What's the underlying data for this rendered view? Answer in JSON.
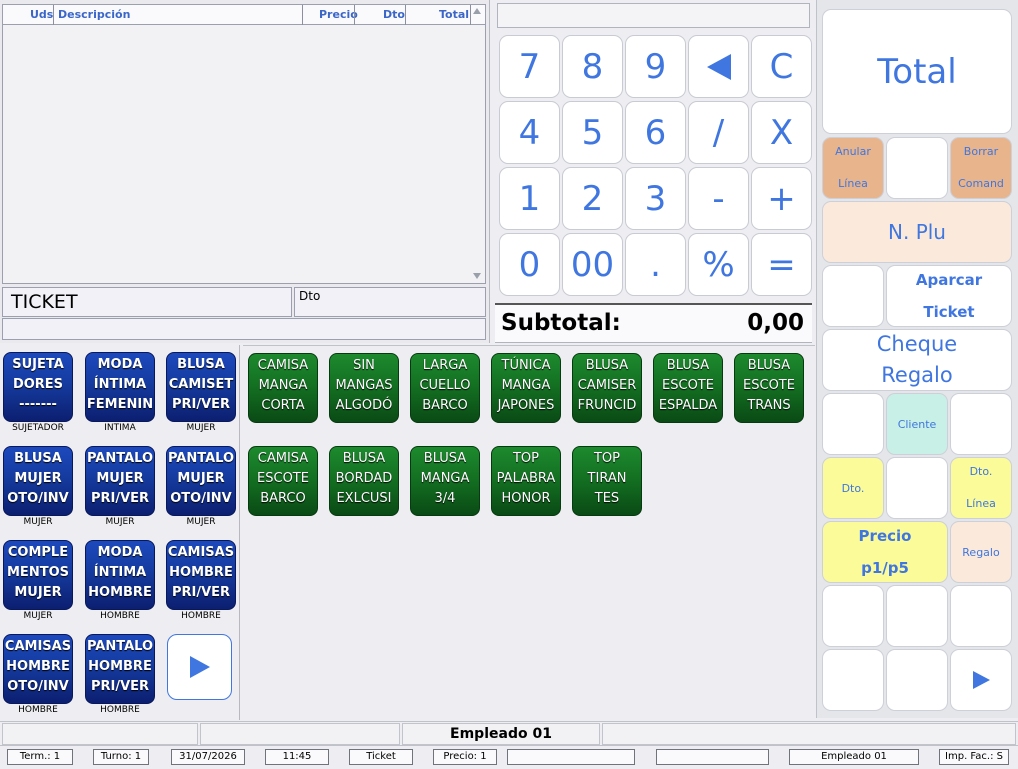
{
  "ticket": {
    "columns": {
      "uds": "Uds",
      "descripcion": "Descripción",
      "precio": "Precio",
      "dto": "Dto",
      "total": "Total"
    },
    "label": "TICKET",
    "dto_label": "Dto"
  },
  "keypad": {
    "rows": [
      [
        "7",
        "8",
        "9",
        "◀",
        "C"
      ],
      [
        "4",
        "5",
        "6",
        "/",
        "X"
      ],
      [
        "1",
        "2",
        "3",
        "-",
        "+"
      ],
      [
        "0",
        "00",
        ".",
        "%",
        "="
      ]
    ]
  },
  "subtotal": {
    "label": "Subtotal:",
    "value": "0,00"
  },
  "right": {
    "total": "Total",
    "anular_linea": [
      "Anular",
      "Línea"
    ],
    "borrar_comanda": [
      "Borrar",
      "Comand"
    ],
    "nplu": "N. Plu",
    "aparcar_ticket": [
      "Aparcar",
      "Ticket"
    ],
    "cheque_regalo": [
      "Cheque",
      "Regalo"
    ],
    "cliente": "Cliente",
    "dto": "Dto.",
    "dto_linea": [
      "Dto.",
      "Línea"
    ],
    "precio": [
      "Precio",
      "p1/p5"
    ],
    "regalo": "Regalo"
  },
  "families": [
    {
      "lines": [
        "SUJETA",
        "DORES",
        "-------"
      ],
      "caption": "SUJETADOR"
    },
    {
      "lines": [
        "MODA",
        "ÍNTIMA",
        "FEMENIN"
      ],
      "caption": "INTIMA"
    },
    {
      "lines": [
        "BLUSA",
        "CAMISET",
        "PRI/VER"
      ],
      "caption": "MUJER"
    },
    {
      "lines": [
        "BLUSA",
        "MUJER",
        "OTO/INV"
      ],
      "caption": "MUJER"
    },
    {
      "lines": [
        "PANTALO",
        "MUJER",
        "PRI/VER"
      ],
      "caption": "MUJER"
    },
    {
      "lines": [
        "PANTALO",
        "MUJER",
        "OTO/INV"
      ],
      "caption": "MUJER"
    },
    {
      "lines": [
        "COMPLE",
        "MENTOS",
        "MUJER"
      ],
      "caption": "MUJER"
    },
    {
      "lines": [
        "MODA",
        "ÍNTIMA",
        "HOMBRE"
      ],
      "caption": "HOMBRE"
    },
    {
      "lines": [
        "CAMISAS",
        "HOMBRE",
        "PRI/VER"
      ],
      "caption": "HOMBRE"
    },
    {
      "lines": [
        "CAMISAS",
        "HOMBRE",
        "OTO/INV"
      ],
      "caption": "HOMBRE"
    },
    {
      "lines": [
        "PANTALO",
        "HOMBRE",
        "PRI/VER"
      ],
      "caption": "HOMBRE"
    }
  ],
  "products": [
    [
      "CAMISA",
      "MANGA",
      "CORTA"
    ],
    [
      "SIN",
      "MANGAS",
      "ALGODÓ"
    ],
    [
      "LARGA",
      "CUELLO",
      "BARCO"
    ],
    [
      "TÚNICA",
      "MANGA",
      "JAPONES"
    ],
    [
      "BLUSA",
      "CAMISER",
      "FRUNCID"
    ],
    [
      "BLUSA",
      "ESCOTE",
      "ESPALDA"
    ],
    [
      "BLUSA",
      "ESCOTE",
      "TRANS"
    ],
    [
      "CAMISA",
      "ESCOTE",
      "BARCO"
    ],
    [
      "BLUSA",
      "BORDAD",
      "EXLCUSI"
    ],
    [
      "BLUSA",
      "MANGA",
      "3/4"
    ],
    [
      "TOP",
      "PALABRA",
      "HONOR"
    ],
    [
      "TOP",
      "TIRAN",
      "TES"
    ]
  ],
  "employee": "Empleado 01",
  "status": {
    "term": "Term.: 1",
    "turno": "Turno: 1",
    "date": "31/07/2026",
    "time": "11:45",
    "doc": "Ticket",
    "precio": "Precio: 1",
    "empleado": "Empleado 01",
    "imp_fac": "Imp. Fac.: S"
  },
  "colors": {
    "accent_blue": "#3f76e0",
    "family_blue": "#153b9f",
    "product_green": "#136e21",
    "salmon": "#e8b48c",
    "peach": "#fbeadb",
    "mint": "#c8f0e6",
    "yellow": "#fbfb9a"
  },
  "icons": {
    "next_families": "play-right-icon",
    "next_panel": "play-right-icon",
    "backspace": "arrow-left-icon"
  }
}
